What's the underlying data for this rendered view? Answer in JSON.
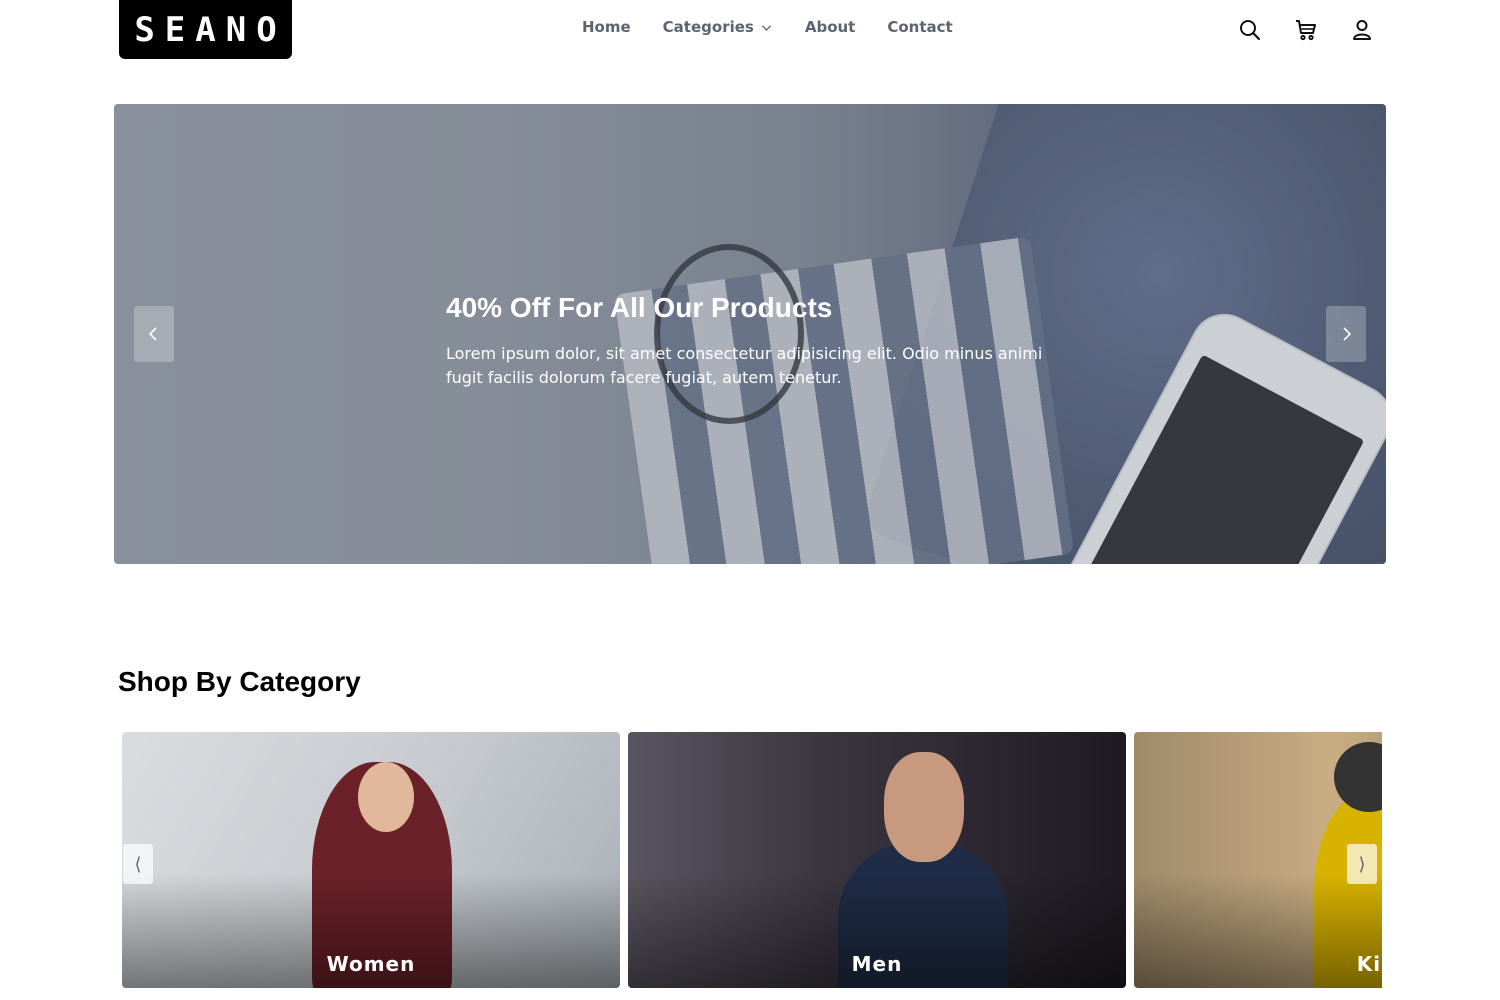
{
  "brand": {
    "logo_text": "SEANO"
  },
  "nav": {
    "home": "Home",
    "categories": "Categories",
    "about": "About",
    "contact": "Contact"
  },
  "header_icons": [
    "search-icon",
    "cart-icon",
    "user-icon"
  ],
  "hero": {
    "title": "40% Off For All Our Products",
    "subtitle": "Lorem ipsum dolor, sit amet consectetur adipisicing elit. Odio minus animi fugit facilis dolorum facere fugiat, autem tenetur."
  },
  "category_section": {
    "title": "Shop By Category",
    "cards": [
      {
        "label": "Women"
      },
      {
        "label": "Men"
      },
      {
        "label": "Kids"
      }
    ]
  },
  "colors": {
    "logo_bg": "#000000",
    "nav_text": "#5c6470",
    "hero_text": "#ffffff"
  }
}
